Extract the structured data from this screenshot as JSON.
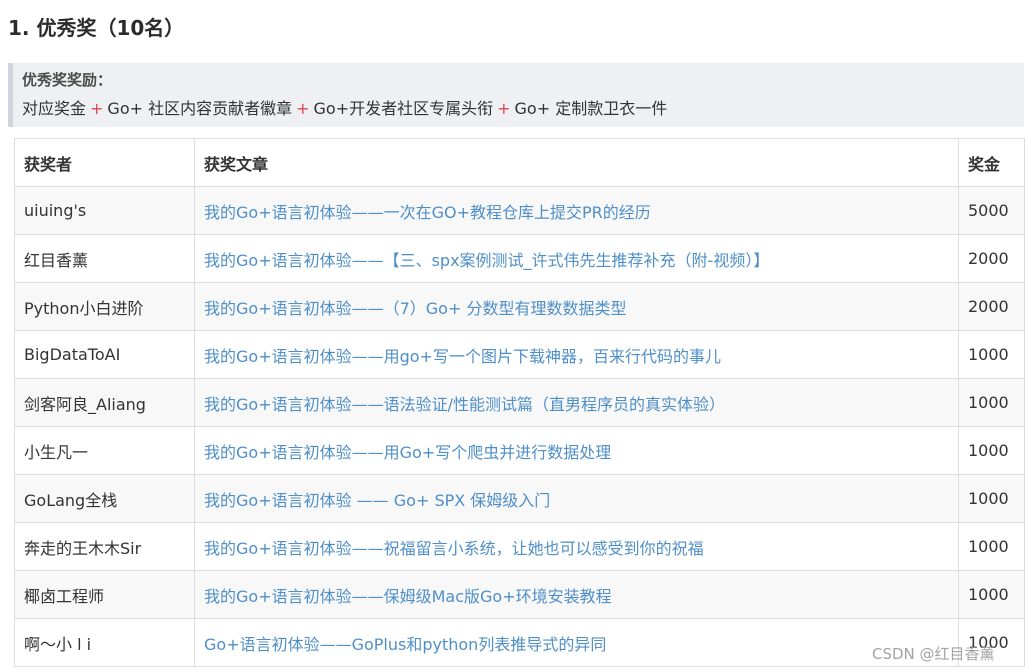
{
  "heading": "1. 优秀奖（10名）",
  "callout": {
    "title": "优秀奖奖励：",
    "items": [
      "对应奖金",
      "Go+ 社区内容贡献者徽章",
      "Go+开发者社区专属头衔",
      "Go+ 定制款卫衣一件"
    ],
    "separator": "+"
  },
  "table": {
    "headers": [
      "获奖者",
      "获奖文章",
      "奖金"
    ],
    "rows": [
      {
        "winner": "uiuing's",
        "article": "我的Go+语言初体验——一次在GO+教程仓库上提交PR的经历",
        "prize": "5000"
      },
      {
        "winner": "红目香薰",
        "article": "我的Go+语言初体验——【三、spx案例测试_许式伟先生推荐补充（附-视频）】",
        "prize": "2000"
      },
      {
        "winner": "Python小白进阶",
        "article": "我的Go+语言初体验——（7）Go+ 分数型有理数数据类型",
        "prize": "2000"
      },
      {
        "winner": "BigDataToAI",
        "article": "我的Go+语言初体验——用go+写一个图片下载神器，百来行代码的事儿",
        "prize": "1000"
      },
      {
        "winner": "剑客阿良_Aliang",
        "article": "我的Go+语言初体验——语法验证/性能测试篇（直男程序员的真实体验）",
        "prize": "1000"
      },
      {
        "winner": "小生凡一",
        "article": "我的Go+语言初体验——用Go+写个爬虫并进行数据处理",
        "prize": "1000"
      },
      {
        "winner": "GoLang全栈",
        "article": "我的Go+语言初体验 —— Go+ SPX 保姆级入门",
        "prize": "1000"
      },
      {
        "winner": "奔走的王木木Sir",
        "article": "我的Go+语言初体验——祝福留言小系统，让她也可以感受到你的祝福",
        "prize": "1000"
      },
      {
        "winner": "椰卤工程师",
        "article": "我的Go+语言初体验——保姆级Mac版Go+环境安装教程",
        "prize": "1000"
      },
      {
        "winner": "啊～小 l i",
        "article": "Go+语言初体验——GoPlus和python列表推导式的异同",
        "prize": "1000"
      }
    ]
  },
  "watermark": "CSDN @红目香薰",
  "colors": {
    "link": "#4f8fc9",
    "plus": "#e0454f",
    "callout_bg": "#eef0f4",
    "row_stripe": "#f8f8f8"
  }
}
